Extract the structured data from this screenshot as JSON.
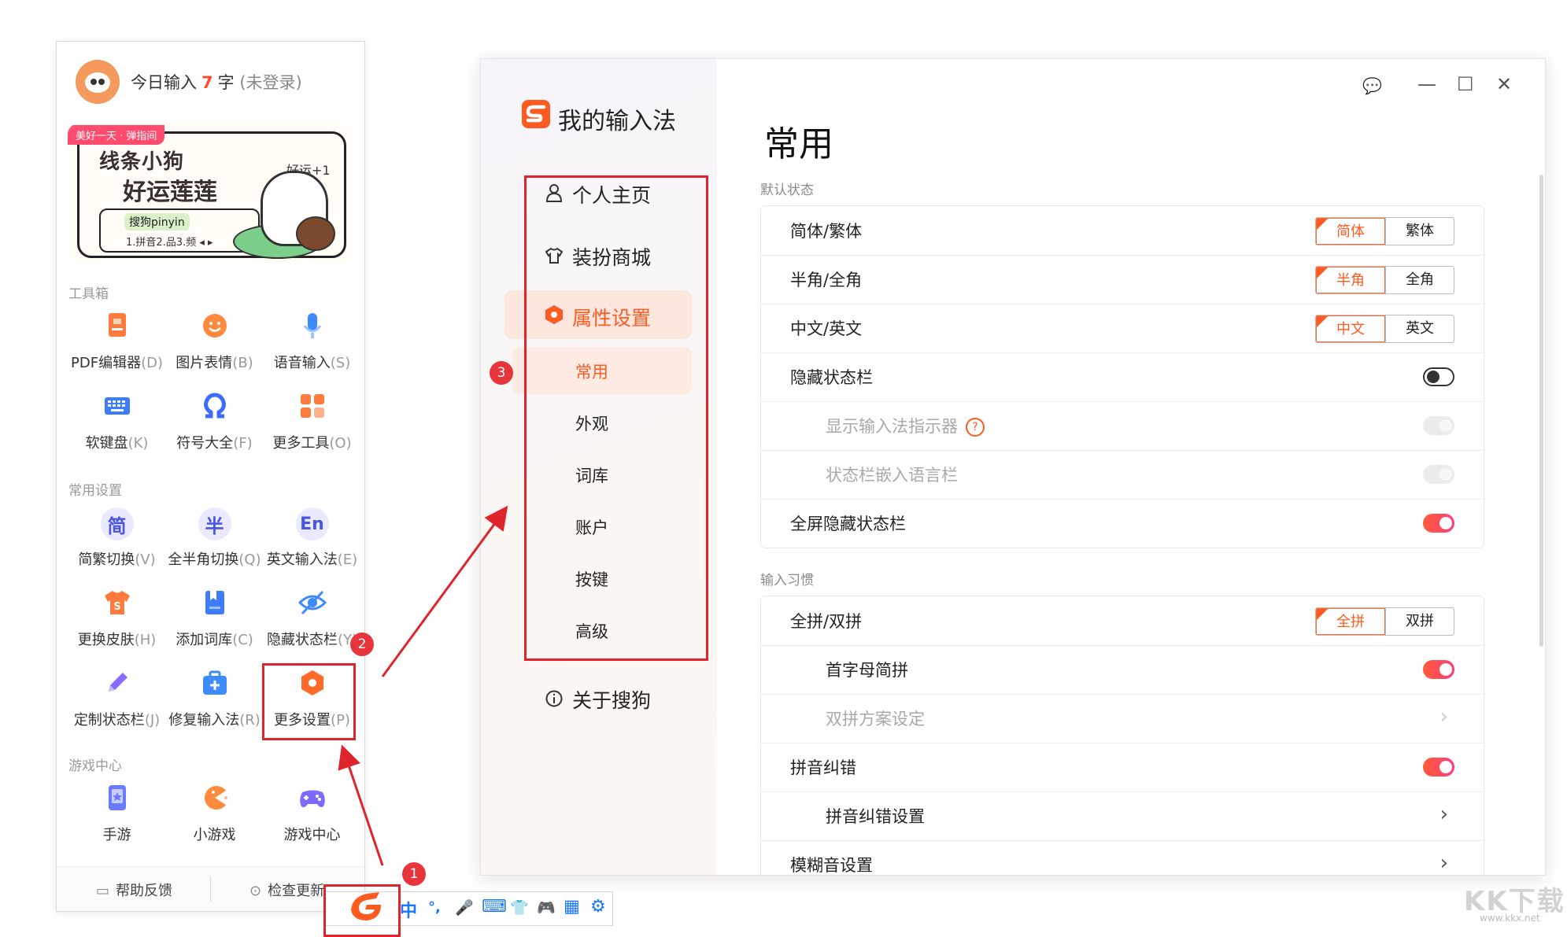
{
  "toolbox": {
    "today_prefix": "今日输入",
    "today_count": "7",
    "today_suffix": "字",
    "login_state": "(未登录)",
    "banner": {
      "tag": "美好一天 · 弹指间",
      "line1": "线条小狗",
      "line2": "好运莲莲",
      "luck": "好运+1",
      "brand": "搜狗pinyin",
      "info": "1.拼音2.品3.频 ◂ ▸"
    },
    "sections": {
      "tools": "工具箱",
      "common": "常用设置",
      "games": "游戏中心"
    },
    "tools": [
      {
        "label": "PDF编辑器",
        "key": "(D)",
        "icon": "pdf-icon",
        "color": "#ff7a3d"
      },
      {
        "label": "图片表情",
        "key": "(B)",
        "icon": "emoji-icon",
        "color": "#ff8a3d"
      },
      {
        "label": "语音输入",
        "key": "(S)",
        "icon": "mic-icon",
        "color": "#3d8bff"
      },
      {
        "label": "软键盘",
        "key": "(K)",
        "icon": "keyboard-icon",
        "color": "#3d7bff"
      },
      {
        "label": "符号大全",
        "key": "(F)",
        "icon": "omega-icon",
        "color": "#3d6bff"
      },
      {
        "label": "更多工具",
        "key": "(O)",
        "icon": "grid-icon",
        "color": "#ff7a3d"
      }
    ],
    "common": [
      {
        "label": "简繁切换",
        "key": "(V)",
        "glyph": "简"
      },
      {
        "label": "全半角切换",
        "key": "(Q)",
        "glyph": "半"
      },
      {
        "label": "英文输入法",
        "key": "(E)",
        "glyph": "En"
      },
      {
        "label": "更换皮肤",
        "key": "(H)",
        "icon": "skin-icon",
        "color": "#ff7a3d"
      },
      {
        "label": "添加词库",
        "key": "(C)",
        "icon": "book-icon",
        "color": "#3d7bff"
      },
      {
        "label": "隐藏状态栏",
        "key": "(Y)",
        "icon": "eye-off-icon",
        "color": "#3d8bff"
      },
      {
        "label": "定制状态栏",
        "key": "(J)",
        "icon": "pencil-icon",
        "color": "#8a6bff"
      },
      {
        "label": "修复输入法",
        "key": "(R)",
        "icon": "repair-icon",
        "color": "#3d8bff"
      },
      {
        "label": "更多设置",
        "key": "(P)",
        "icon": "hexagon-icon",
        "color": "#ff6a2a"
      }
    ],
    "games": [
      {
        "label": "手游",
        "icon": "phone-game-icon",
        "color": "#6b7bff"
      },
      {
        "label": "小游戏",
        "icon": "pacman-icon",
        "color": "#ff8a3d"
      },
      {
        "label": "游戏中心",
        "icon": "gamepad-icon",
        "color": "#7b6bff"
      }
    ],
    "footer": {
      "help": "帮助反馈",
      "update": "检查更新"
    }
  },
  "taskbar": {
    "items": [
      "中",
      "°,",
      "🎤",
      "⌨",
      "👕",
      "🎮",
      "▦",
      "⚙"
    ]
  },
  "badges": {
    "one": "1",
    "two": "2",
    "three": "3"
  },
  "window": {
    "app_title": "我的输入法",
    "controls": {
      "feedback": "💬",
      "minimize": "—",
      "maximize": "☐",
      "close": "✕"
    },
    "nav": [
      {
        "label": "个人主页",
        "icon": "user-icon"
      },
      {
        "label": "装扮商城",
        "icon": "shirt-icon"
      },
      {
        "label": "属性设置",
        "icon": "hexagon-icon"
      },
      {
        "label": "关于搜狗",
        "icon": "info-icon"
      }
    ],
    "subnav": [
      "常用",
      "外观",
      "词库",
      "账户",
      "按键",
      "高级"
    ],
    "page_title": "常用",
    "groups": {
      "default_state": "默认状态",
      "input_habits": "输入习惯"
    },
    "default_rows": [
      {
        "label": "简体/繁体",
        "type": "seg",
        "on": "简体",
        "off": "繁体"
      },
      {
        "label": "半角/全角",
        "type": "seg",
        "on": "半角",
        "off": "全角"
      },
      {
        "label": "中文/英文",
        "type": "seg",
        "on": "中文",
        "off": "英文"
      },
      {
        "label": "隐藏状态栏",
        "type": "toggle",
        "state": "off"
      },
      {
        "label": "显示输入法指示器",
        "type": "toggle",
        "state": "disabled",
        "sub": true,
        "help": "?"
      },
      {
        "label": "状态栏嵌入语言栏",
        "type": "toggle",
        "state": "disabled",
        "sub": true
      },
      {
        "label": "全屏隐藏状态栏",
        "type": "toggle",
        "state": "on"
      }
    ],
    "habit_rows": [
      {
        "label": "全拼/双拼",
        "type": "seg",
        "on": "全拼",
        "off": "双拼"
      },
      {
        "label": "首字母简拼",
        "type": "toggle",
        "state": "on",
        "sub": true
      },
      {
        "label": "双拼方案设定",
        "type": "link",
        "sub": true,
        "disabled": true
      },
      {
        "label": "拼音纠错",
        "type": "toggle",
        "state": "on"
      },
      {
        "label": "拼音纠错设置",
        "type": "link",
        "sub": true
      },
      {
        "label": "模糊音设置",
        "type": "link"
      }
    ],
    "chevron": "›"
  },
  "watermark": {
    "main": "KK下载",
    "sub": "www.kkx.net"
  }
}
